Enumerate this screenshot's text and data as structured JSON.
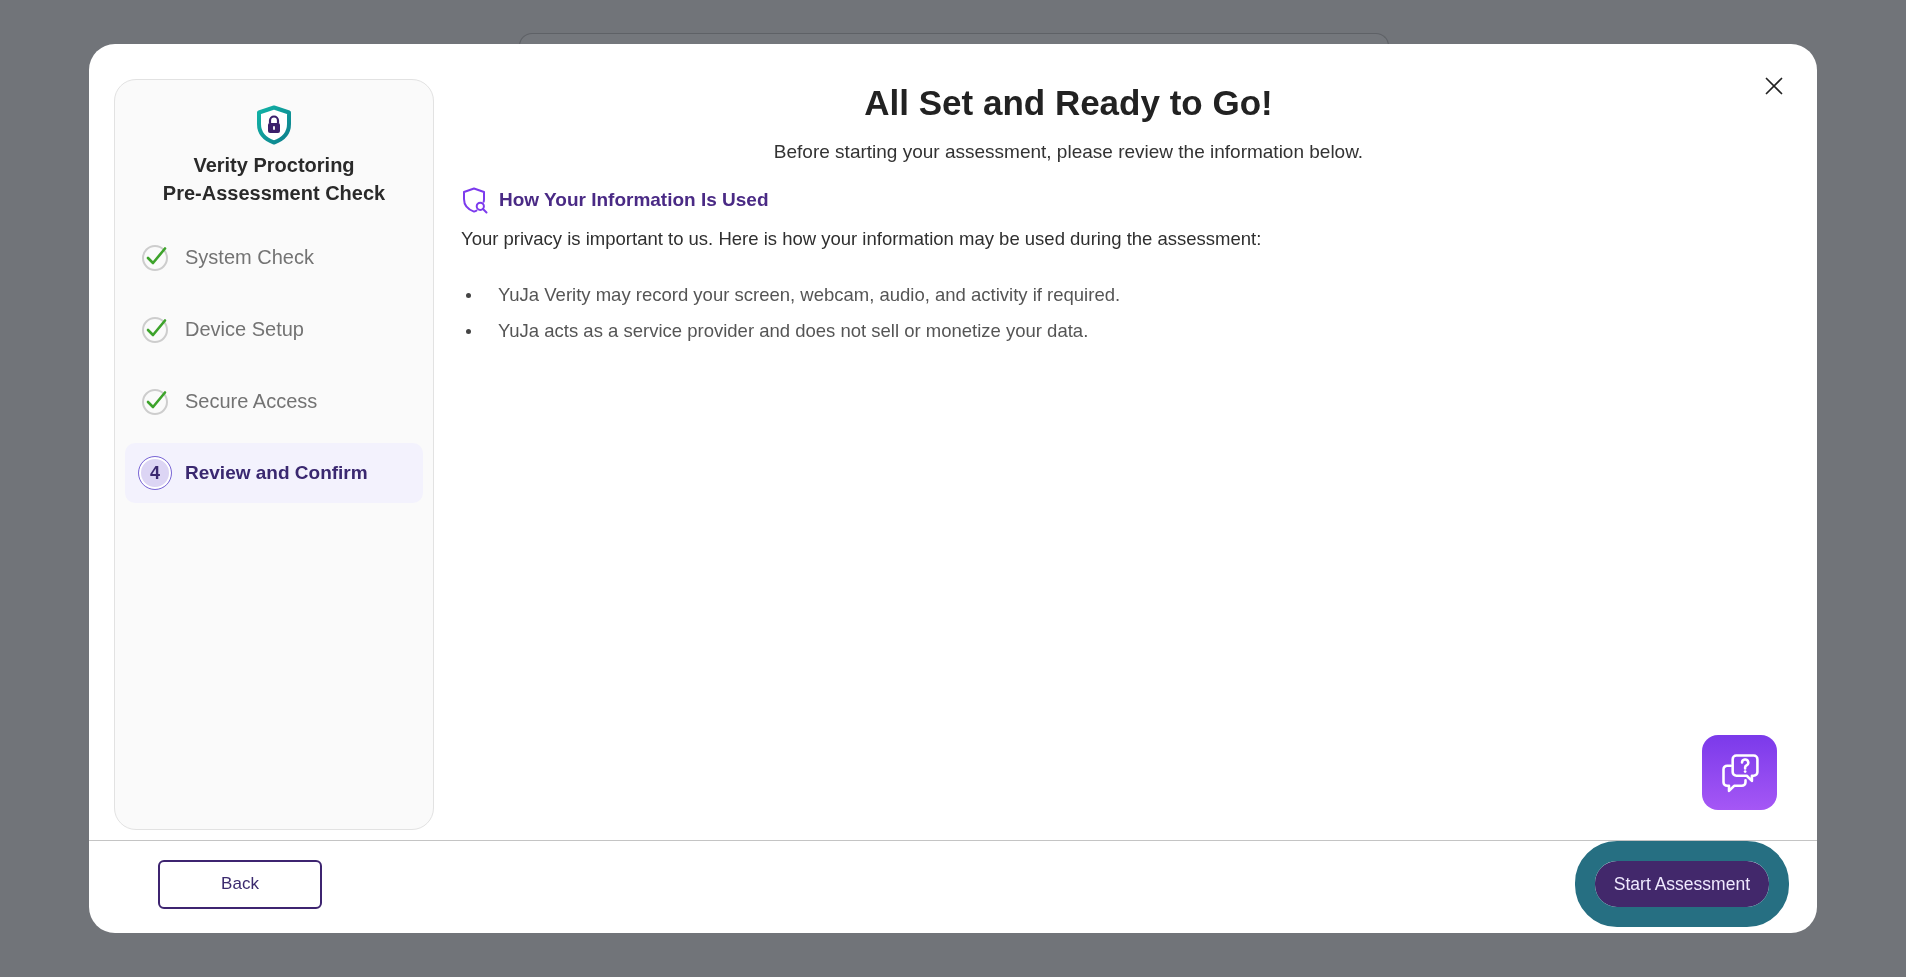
{
  "sidebar": {
    "title": "Verity Proctoring\nPre-Assessment Check",
    "steps": [
      {
        "label": "System Check",
        "completed": true,
        "selected": false
      },
      {
        "label": "Device Setup",
        "completed": true,
        "selected": false
      },
      {
        "label": "Secure Access",
        "completed": true,
        "selected": false
      },
      {
        "label": "Review and Confirm",
        "number": "4",
        "completed": false,
        "selected": true
      }
    ]
  },
  "main": {
    "title": "All Set and Ready to Go!",
    "subtitle": "Before starting your assessment, please review the information below.",
    "section": {
      "heading": "How Your Information Is Used",
      "intro": "Your privacy is important to us. Here is how your information may be used during the assessment:",
      "bullets": [
        "YuJa Verity may record your screen, webcam, audio, and activity if required.",
        "YuJa acts as a service provider and does not sell or monetize your data."
      ]
    }
  },
  "footer": {
    "back_button": "Back",
    "start_button": {
      "label": "Start Assessment",
      "focused": true
    }
  }
}
